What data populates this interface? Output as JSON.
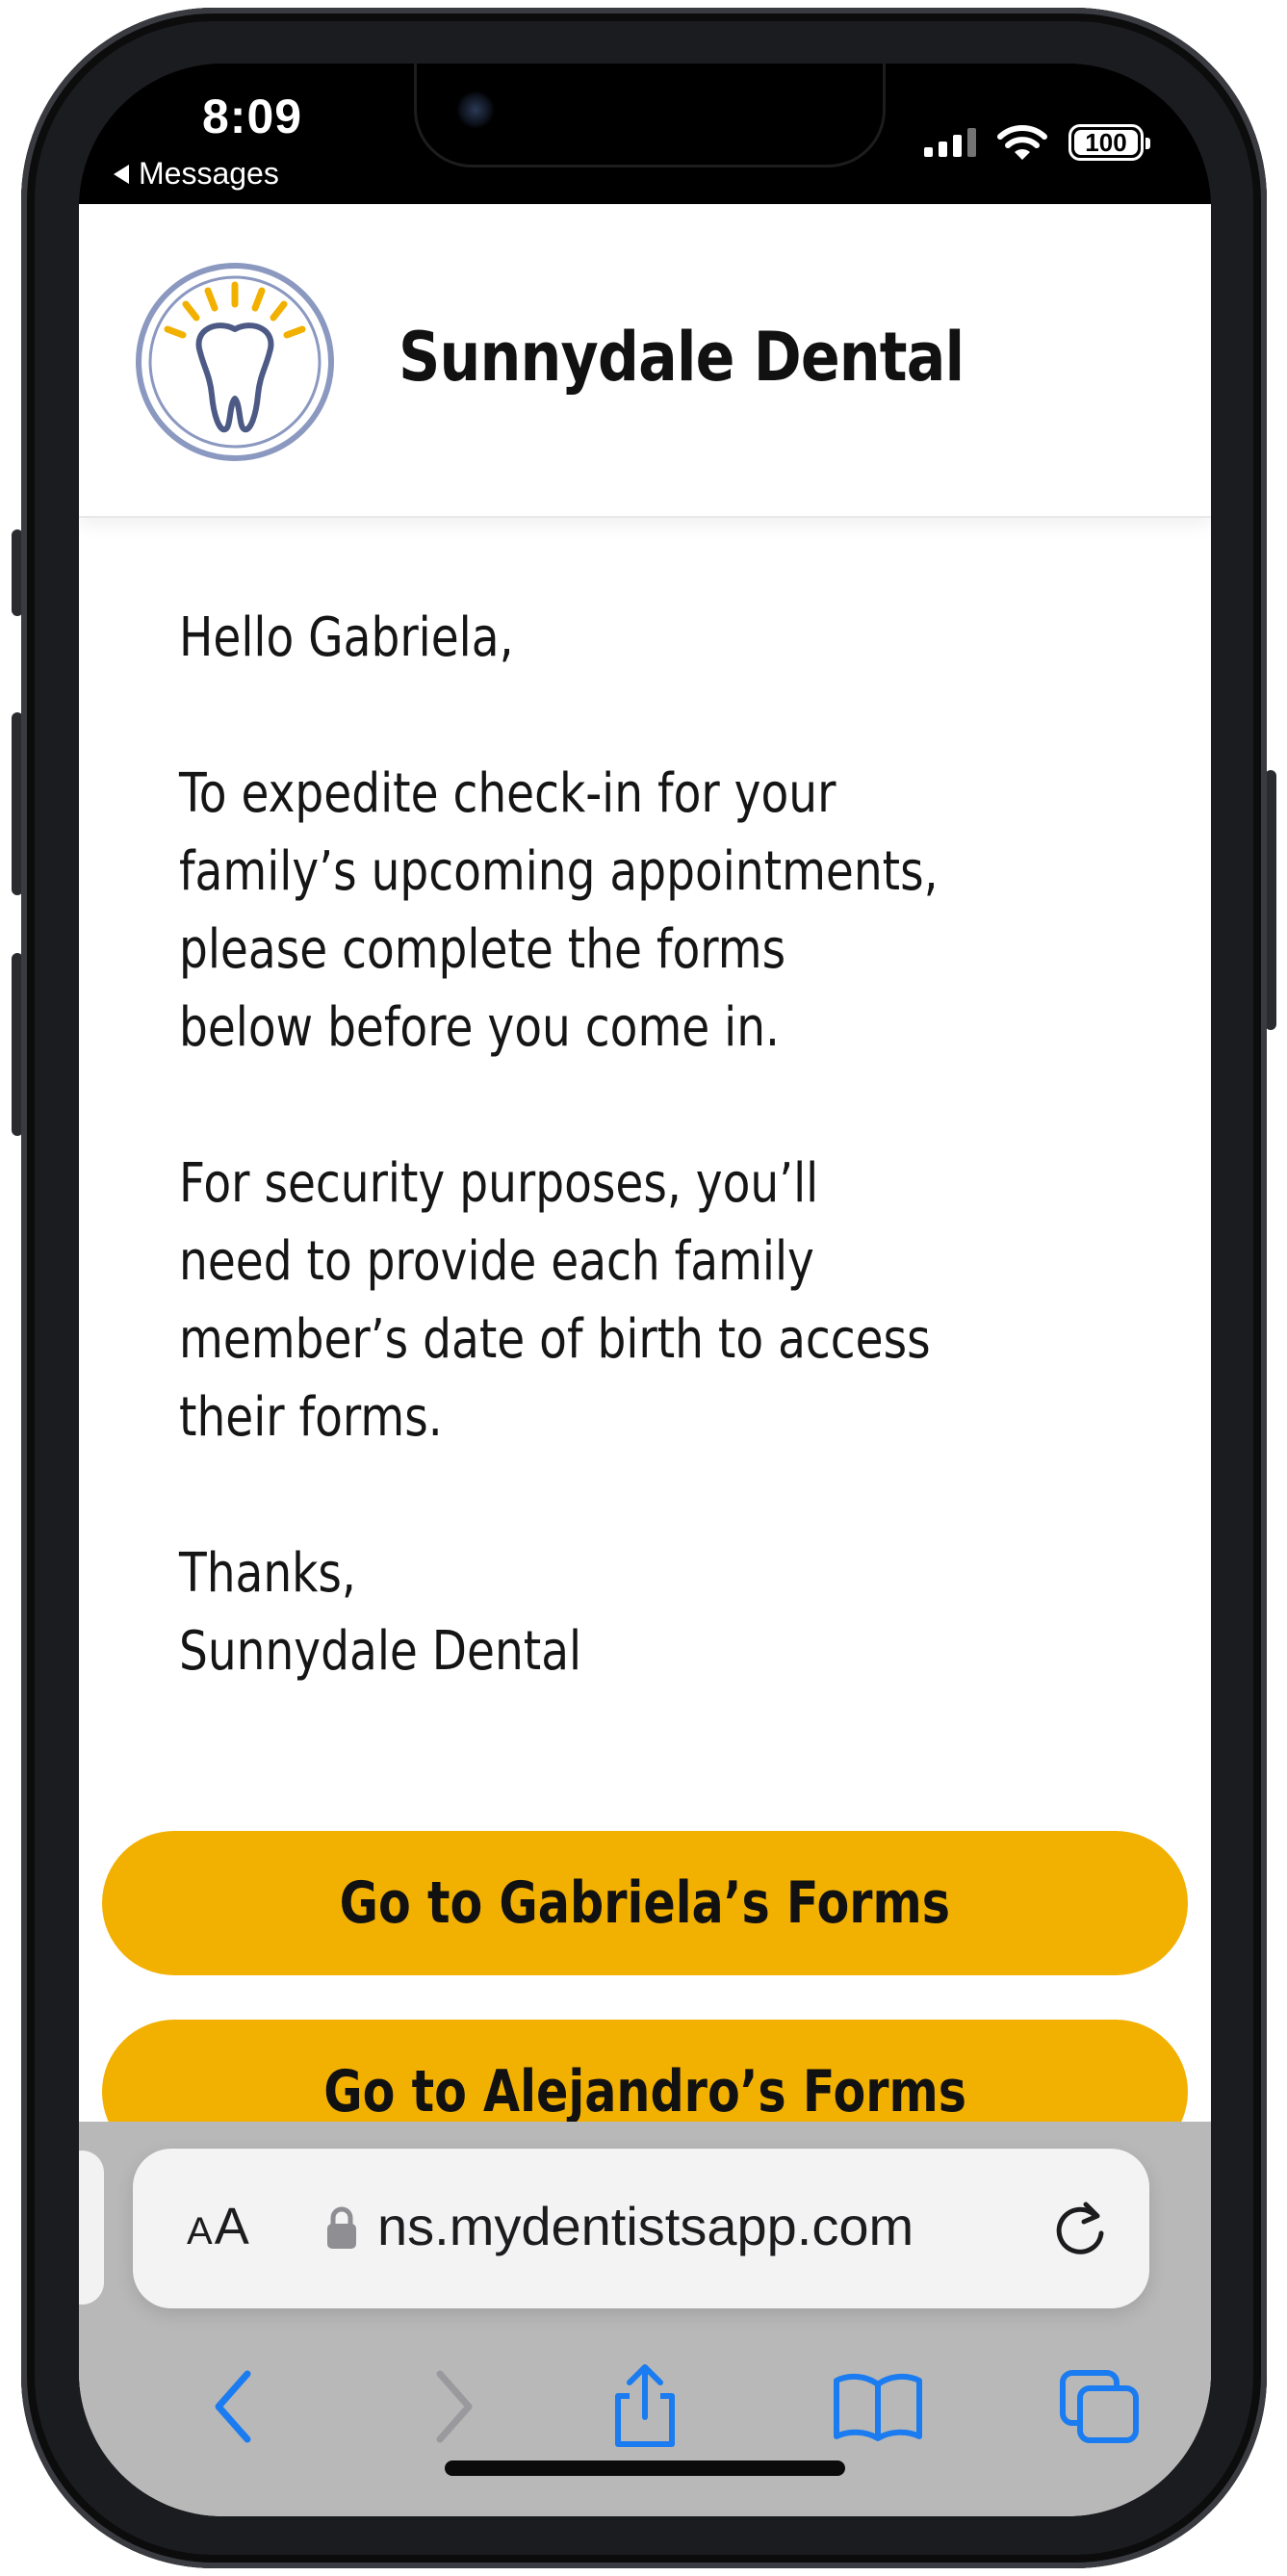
{
  "status_bar": {
    "time": "8:09",
    "back_app": "Messages",
    "battery": "100"
  },
  "site": {
    "name": "Sunnydale Dental",
    "logo_icon": "tooth-icon"
  },
  "message": {
    "greeting": "Hello Gabriela,",
    "paragraph1_lines": [
      "To expedite check-in for your",
      "family’s upcoming appointments,",
      "please complete the forms",
      "below before you come in."
    ],
    "paragraph2_lines": [
      "For security purposes, you’ll",
      "need to provide each family",
      "member’s date of birth to access",
      "their forms."
    ],
    "signoff": "Thanks,",
    "signature": "Sunnydale Dental"
  },
  "buttons": {
    "gabriela": "Go to Gabriela’s Forms",
    "alejandro": "Go to Alejandro’s Forms"
  },
  "browser": {
    "text_size_small": "A",
    "text_size_large": "A",
    "url": "ns.mydentistsapp.com",
    "accent_color": "#1a7cf0"
  },
  "colors": {
    "cta_background": "#f2b000",
    "logo_ring": "#8b98c0",
    "logo_rays": "#f2b000"
  }
}
